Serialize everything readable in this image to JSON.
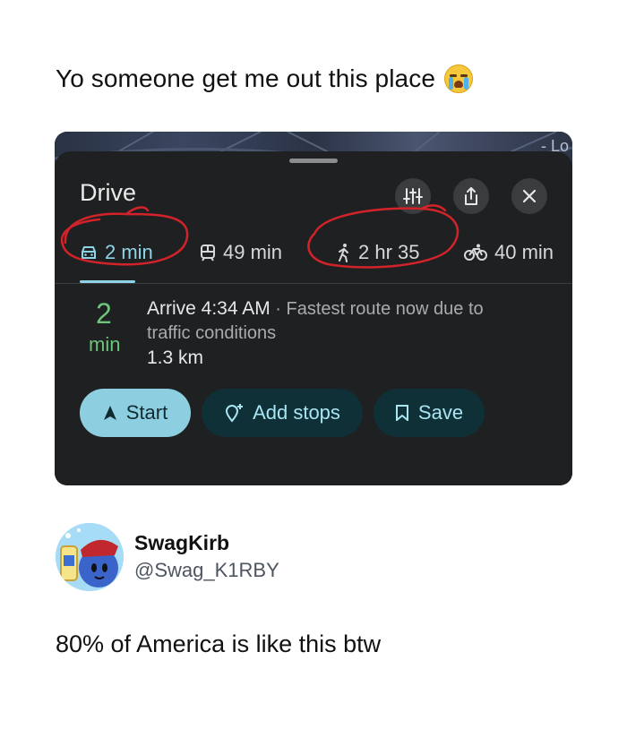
{
  "post": {
    "caption": "Yo someone get me out this place",
    "emoji": "loudly-crying-face"
  },
  "map_screenshot": {
    "map_label": "- Lo",
    "mode_title": "Drive",
    "header_icons": [
      "filter-icon",
      "share-icon",
      "close-icon"
    ],
    "tabs": [
      {
        "icon": "car-icon",
        "label": "2 min",
        "active": true
      },
      {
        "icon": "transit-icon",
        "label": "49 min",
        "active": false
      },
      {
        "icon": "walk-icon",
        "label": "2 hr 35",
        "active": false
      },
      {
        "icon": "bike-icon",
        "label": "40 min",
        "active": false
      }
    ],
    "duration_value": "2",
    "duration_unit": "min",
    "arrive_time": "Arrive 4:34 AM",
    "arrive_note": " · Fastest route now due to traffic conditions",
    "distance": "1.3 km",
    "buttons": {
      "start": "Start",
      "add_stops": "Add stops",
      "save": "Save"
    },
    "colors": {
      "accent": "#8fd4e6",
      "duration_green": "#6cc57a",
      "annotation_red": "#d3232a"
    }
  },
  "profile": {
    "display_name": "SwagKirb",
    "handle": "@Swag_K1RBY"
  },
  "tweet": {
    "text": "80% of America is like this btw"
  }
}
